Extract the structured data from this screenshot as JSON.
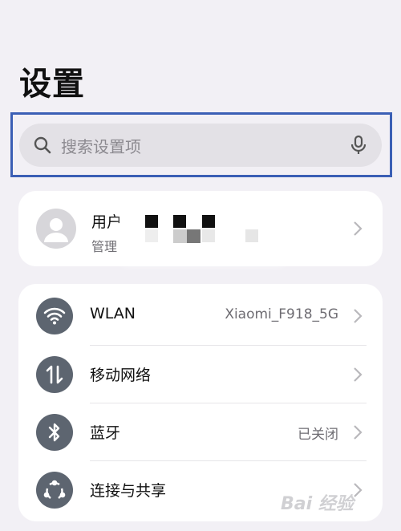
{
  "page": {
    "title": "设置"
  },
  "search": {
    "placeholder": "搜索设置项",
    "icon": "search-icon",
    "mic_icon": "microphone-icon"
  },
  "account": {
    "name": "用户",
    "subtitle": "管理",
    "avatar_icon": "user-avatar-icon"
  },
  "settings": [
    {
      "label": "WLAN",
      "value": "Xiaomi_F918_5G",
      "icon": "wifi-icon"
    },
    {
      "label": "移动网络",
      "value": "",
      "icon": "mobile-data-icon"
    },
    {
      "label": "蓝牙",
      "value": "已关闭",
      "icon": "bluetooth-icon"
    },
    {
      "label": "连接与共享",
      "value": "",
      "icon": "share-icon"
    }
  ],
  "watermark": {
    "text": "Bai 经验"
  },
  "colors": {
    "accent_frame": "#3b5fb5",
    "icon_bg": "#5d6570",
    "background": "#f2f0f5"
  }
}
